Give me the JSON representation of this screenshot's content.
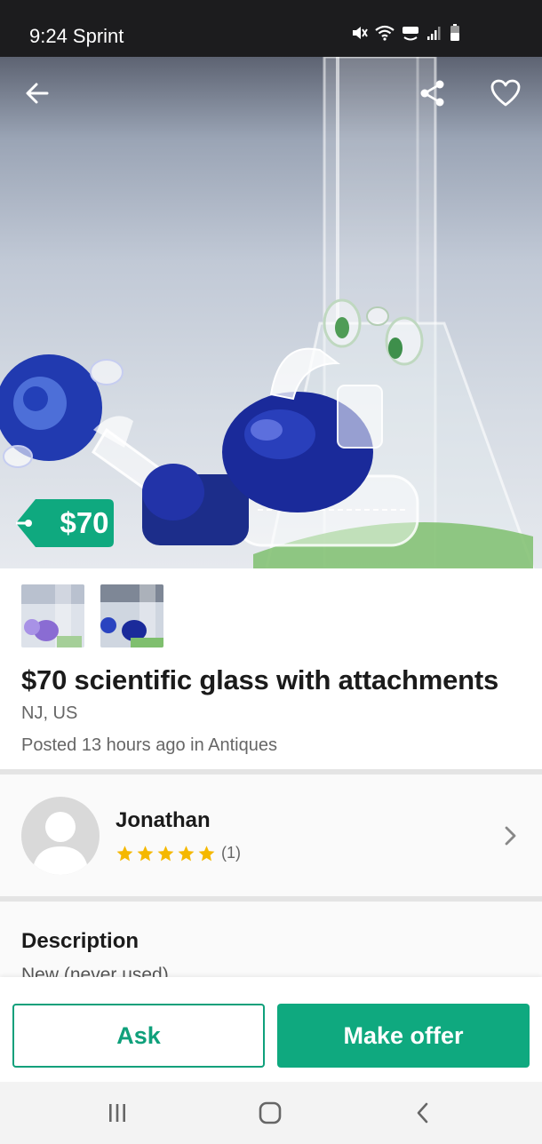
{
  "status_bar": {
    "time": "9:24 Sprint"
  },
  "listing": {
    "price_tag": "$70",
    "title": "$70 scientific glass with attachments",
    "location": "NJ, US",
    "posted": "Posted 13 hours ago in Antiques"
  },
  "seller": {
    "name": "Jonathan",
    "rating_stars": 5,
    "rating_count": "(1)"
  },
  "description": {
    "heading": "Description",
    "text": "New (never used)"
  },
  "actions": {
    "ask_label": "Ask",
    "offer_label": "Make offer"
  },
  "colors": {
    "accent": "#0fa97f",
    "star": "#f5b800",
    "status_bar": "#1c1c1e"
  },
  "icons": [
    "back-arrow-icon",
    "share-icon",
    "heart-icon",
    "chevron-right-icon",
    "recent-apps-icon",
    "home-icon",
    "nav-back-icon"
  ]
}
